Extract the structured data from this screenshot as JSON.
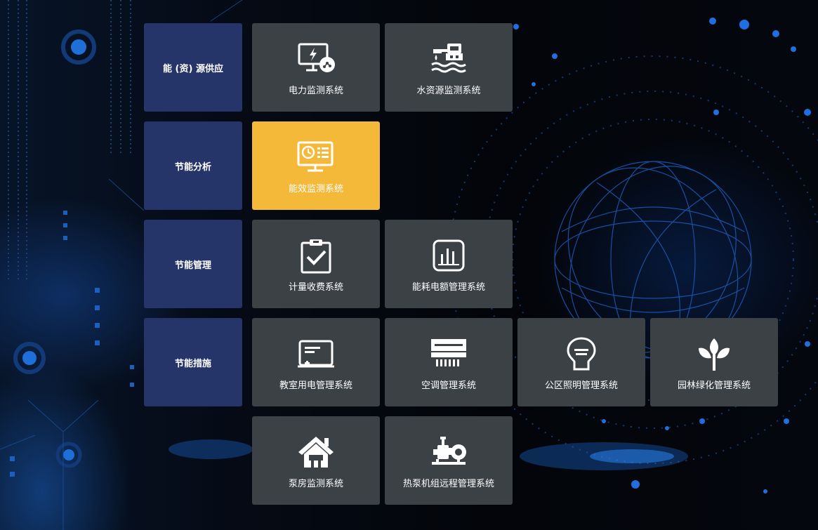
{
  "colors": {
    "category_bg": "#25356a",
    "system_bg": "#3c4146",
    "system_active_bg": "#f5b93a",
    "text": "#ffffff"
  },
  "categories": [
    {
      "label": "能 (资) 源供应"
    },
    {
      "label": "节能分析"
    },
    {
      "label": "节能管理"
    },
    {
      "label": "节能措施"
    }
  ],
  "systems": [
    {
      "label": "电力监测系统",
      "icon": "power-monitor-icon"
    },
    {
      "label": "水资源监测系统",
      "icon": "water-resource-icon"
    },
    {
      "label": "能效监测系统",
      "icon": "energy-efficiency-icon",
      "active": true
    },
    {
      "label": "计量收费系统",
      "icon": "clipboard-check-icon"
    },
    {
      "label": "能耗电额管理系统",
      "icon": "bar-chart-icon"
    },
    {
      "label": "教室用电管理系统",
      "icon": "classroom-board-icon"
    },
    {
      "label": "空调管理系统",
      "icon": "air-conditioner-icon"
    },
    {
      "label": "公区照明管理系统",
      "icon": "light-bulb-icon"
    },
    {
      "label": "园林绿化管理系统",
      "icon": "plant-sprout-icon"
    },
    {
      "label": "泵房监测系统",
      "icon": "pump-house-icon"
    },
    {
      "label": "热泵机组远程管理系统",
      "icon": "heat-pump-icon"
    }
  ]
}
